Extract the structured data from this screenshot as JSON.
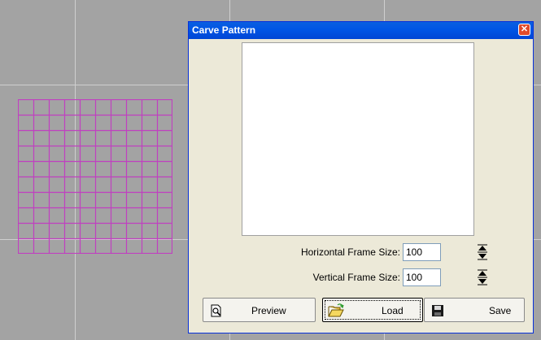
{
  "dialog": {
    "title": "Carve Pattern",
    "close_icon": "close-icon"
  },
  "fields": {
    "horizontal_label": "Horizontal Frame Size:",
    "horizontal_value": "100",
    "vertical_label": "Vertical Frame Size:",
    "vertical_value": "100"
  },
  "buttons": {
    "preview_label": "Preview",
    "load_label": "Load",
    "save_label": "Save"
  },
  "colors": {
    "pattern_grid": "#c040c0",
    "titlebar": "#0055e5",
    "canvas": "#a3a3a3"
  }
}
